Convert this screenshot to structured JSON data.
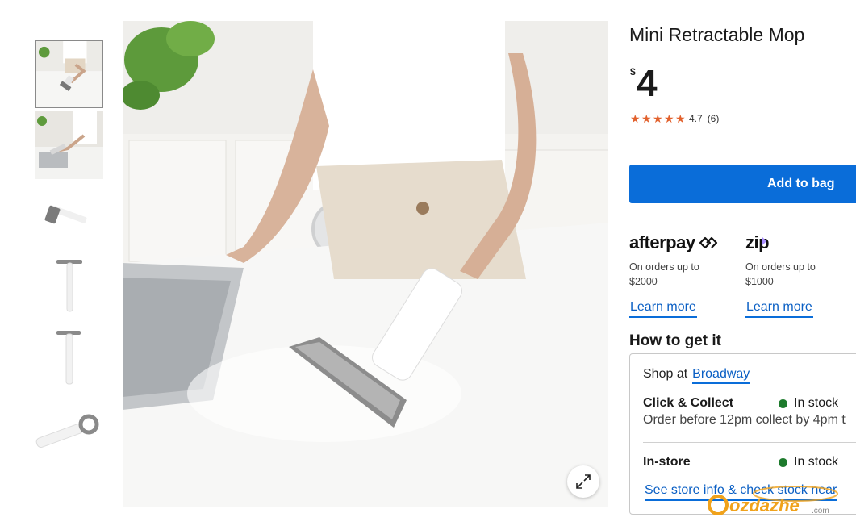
{
  "product": {
    "title": "Mini Retractable Mop",
    "currency": "$",
    "price": "4",
    "rating": {
      "value": "4.7",
      "count": "(6)",
      "stars": 5,
      "star_color": "#e2612d"
    },
    "add_to_bag": "Add to bag"
  },
  "payments": [
    {
      "brand": "afterpay",
      "note_line1": "On orders up to",
      "note_line2": "$2000",
      "learn": "Learn more"
    },
    {
      "brand": "zip",
      "note_line1": "On orders up to",
      "note_line2": "$1000",
      "learn": "Learn more"
    }
  ],
  "fulfilment": {
    "heading": "How to get it",
    "shop_at_label": "Shop at",
    "store_name": "Broadway",
    "click_collect": {
      "label": "Click & Collect",
      "status": "In stock",
      "note": "Order before 12pm collect by 4pm t"
    },
    "in_store": {
      "label": "In-store",
      "status": "In stock"
    },
    "store_info_link": "See store info & check stock near",
    "status_color": "#1d7a2c"
  },
  "gallery": {
    "thumbnails": [
      {
        "icon": "mop-in-use-photo",
        "selected": true
      },
      {
        "icon": "mop-at-sink-photo",
        "selected": false
      },
      {
        "icon": "mop-head-photo",
        "selected": false
      },
      {
        "icon": "mop-extended-photo",
        "selected": false
      },
      {
        "icon": "mop-side-photo",
        "selected": false
      },
      {
        "icon": "mop-handle-photo",
        "selected": false
      }
    ],
    "expand_icon": "expand-arrows-icon"
  },
  "watermark": {
    "text": "ozdazhe",
    "suffix": ".com"
  },
  "colors": {
    "accent": "#0a6dd9",
    "link": "#0a5fc4"
  }
}
